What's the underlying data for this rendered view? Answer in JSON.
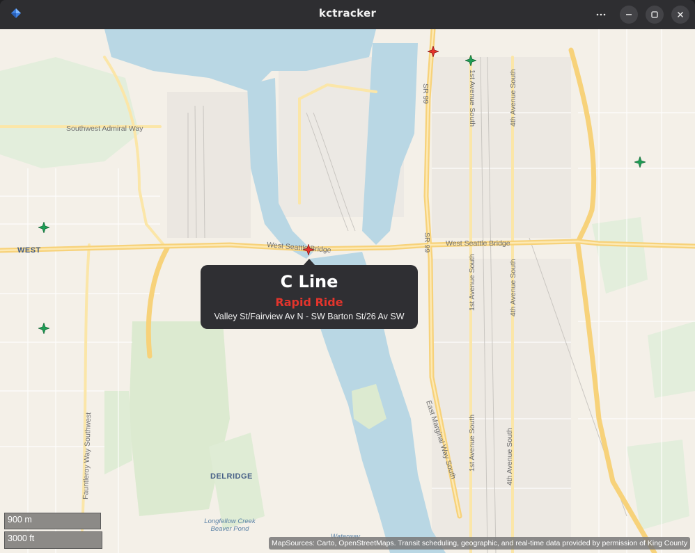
{
  "window": {
    "title": "kctracker"
  },
  "colors": {
    "rapid_ride": "#e3342c",
    "regular_bus": "#1f9d55",
    "water": "#b9d7e4",
    "park": "#dcead0",
    "highway": "#f7d27a"
  },
  "icons": {
    "app": "app-icon",
    "menu": "more-icon",
    "minimize": "minimize-icon",
    "maximize": "maximize-icon",
    "close": "close-icon"
  },
  "map": {
    "road_labels": {
      "sw_admiral": "Southwest Admiral Way",
      "sr99_top": "SR 99",
      "sr99_mid": "SR 99",
      "first_ave_top": "1st Avenue South",
      "fourth_ave_top": "4th Avenue South",
      "wsb_left": "West Seattle Bridge",
      "wsb_right": "West Seattle Bridge",
      "first_ave_mid": "1st Avenue South",
      "fourth_ave_mid": "4th Avenue South",
      "east_marginal": "East Marginal Way South",
      "first_ave_low": "1st Avenue South",
      "fourth_ave_low": "4th Avenue South",
      "fauntleroy": "Fauntleroy Way Southwest"
    },
    "area_labels": {
      "west": "WEST",
      "delridge": "DELRIDGE"
    },
    "water_labels": {
      "creek": "Longfellow Creek\nBeaver Pond",
      "waterway": "Waterway"
    }
  },
  "popup": {
    "route": "C Line",
    "route_type": "Rapid Ride",
    "description": "Valley St/Fairview Av N - SW Barton St/26 Av SW"
  },
  "scale": {
    "metric": "900 m",
    "imperial": "3000 ft"
  },
  "attribution": "MapSources: Carto, OpenStreetMaps. Transit scheduling, geographic, and real-time data provided by permission of King County",
  "vehicles": [
    {
      "route_type": "rapid",
      "color": "#e3342c"
    },
    {
      "route_type": "regular",
      "color": "#1f9d55"
    },
    {
      "route_type": "regular",
      "color": "#1f9d55"
    },
    {
      "route_type": "regular",
      "color": "#1f9d55"
    },
    {
      "route_type": "regular",
      "color": "#1f9d55"
    },
    {
      "route_type": "rapid",
      "color": "#e3342c"
    }
  ]
}
